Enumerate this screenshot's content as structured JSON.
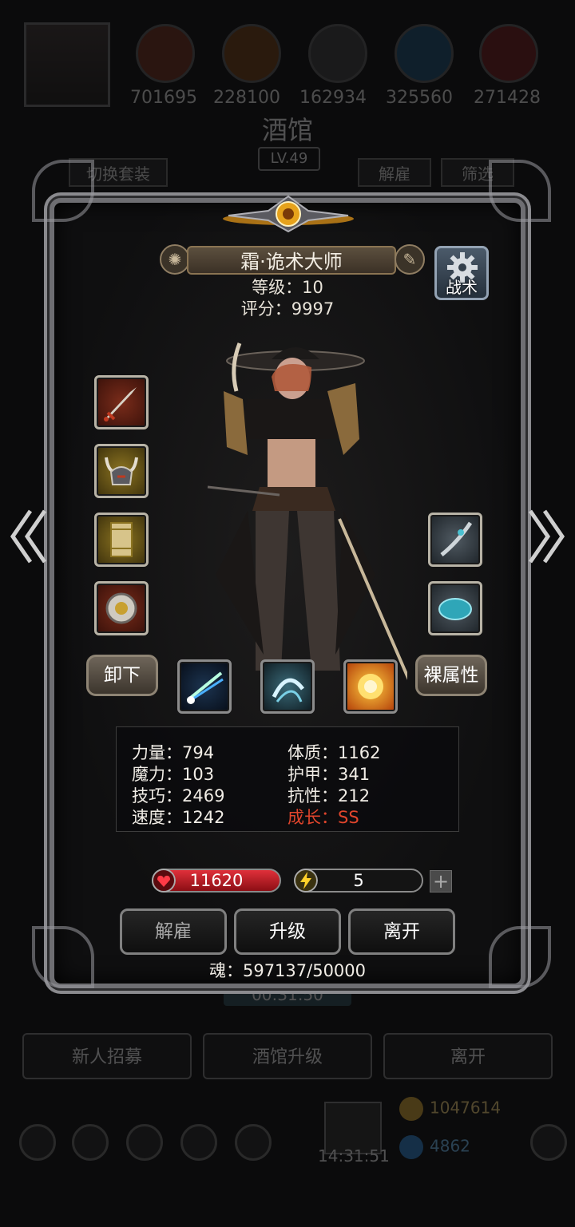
{
  "background": {
    "resources": [
      "701695",
      "228100",
      "162934",
      "325560",
      "271428"
    ],
    "title": "酒馆",
    "level": "LV.49",
    "switch_outfit_label": "切换套装",
    "dismiss_label": "解雇",
    "filter_label": "筛选",
    "timer": "00:31:50",
    "recruit_label": "新人招募",
    "upgrade_tavern_label": "酒馆升级",
    "leave_label": "离开",
    "chest_timer": "14:31:51",
    "gold": "1047614",
    "gems": "4862"
  },
  "hero": {
    "name": "霜·诡术大师",
    "level_text": "等级：10",
    "score_text": "评分：9997",
    "tactics_label": "战术"
  },
  "equipment": {
    "left_slots": [
      "weapon-dagger",
      "helmet-horned",
      "scroll-armor",
      "ring-amulet"
    ],
    "right_slots": [
      "blade-offhand",
      "gem-teal"
    ],
    "unequip_label": "卸下",
    "base_attr_label": "裸属性",
    "skills": [
      "skill-light-beam",
      "skill-whirl-slash",
      "skill-fire-burst"
    ]
  },
  "stats": {
    "strength": "力量：794",
    "magic": "魔力：103",
    "skill": "技巧：2469",
    "speed": "速度：1242",
    "constitution": "体质：1162",
    "armor": "护甲：341",
    "resistance": "抗性：212",
    "growth": "成长：SS"
  },
  "bars": {
    "hp": "11620",
    "energy": "5",
    "plus": "+"
  },
  "actions": {
    "dismiss": "解雇",
    "upgrade": "升级",
    "leave": "离开"
  },
  "soul_text": "魂：597137/50000",
  "colors": {
    "growth": "#e0452c",
    "hp_bar": "#c0161c",
    "panel_border": "#6e6e72"
  }
}
